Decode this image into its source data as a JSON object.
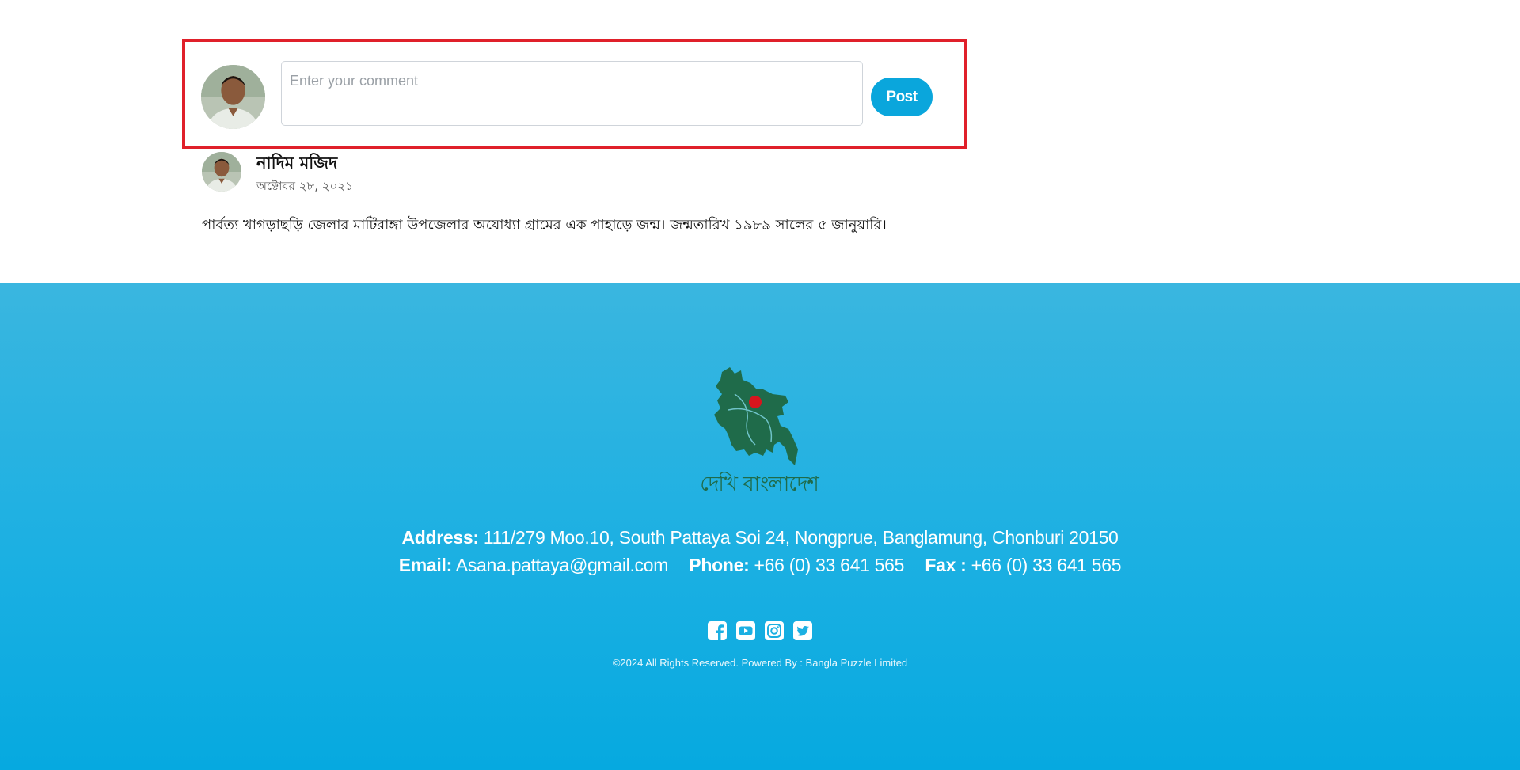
{
  "comment_form": {
    "placeholder": "Enter your comment",
    "post_label": "Post",
    "highlight_color": "#e0202a",
    "button_color": "#0aa6dc"
  },
  "comment": {
    "author": "নাদিম মজিদ",
    "date": "অক্টোবর ২৮, ২০২১",
    "text": "পার্বত্য খাগড়াছড়ি জেলার মাটিরাঙ্গা উপজেলার অযোধ্যা গ্রামের এক পাহাড়ে জন্ম। জন্মতারিখ ১৯৮৯ সালের ৫ জানুয়ারি।"
  },
  "footer": {
    "logo_text": "দেখি বাংলাদেশ",
    "address_label": "Address:",
    "address_value": "111/279 Moo.10, South Pattaya Soi 24, Nongprue, Banglamung, Chonburi 20150",
    "email_label": "Email:",
    "email_value": "Asana.pattaya@gmail.com",
    "phone_label": "Phone:",
    "phone_value": "+66 (0) 33 641 565",
    "fax_label": "Fax :",
    "fax_value": "+66 (0) 33 641 565",
    "social_icons": [
      "facebook-icon",
      "youtube-icon",
      "instagram-icon",
      "twitter-icon"
    ],
    "copyright": "©2024 All Rights Reserved. Powered By : Bangla Puzzle Limited",
    "background_color": "#1cb0e2",
    "logo_color": "#1f6b4a"
  }
}
